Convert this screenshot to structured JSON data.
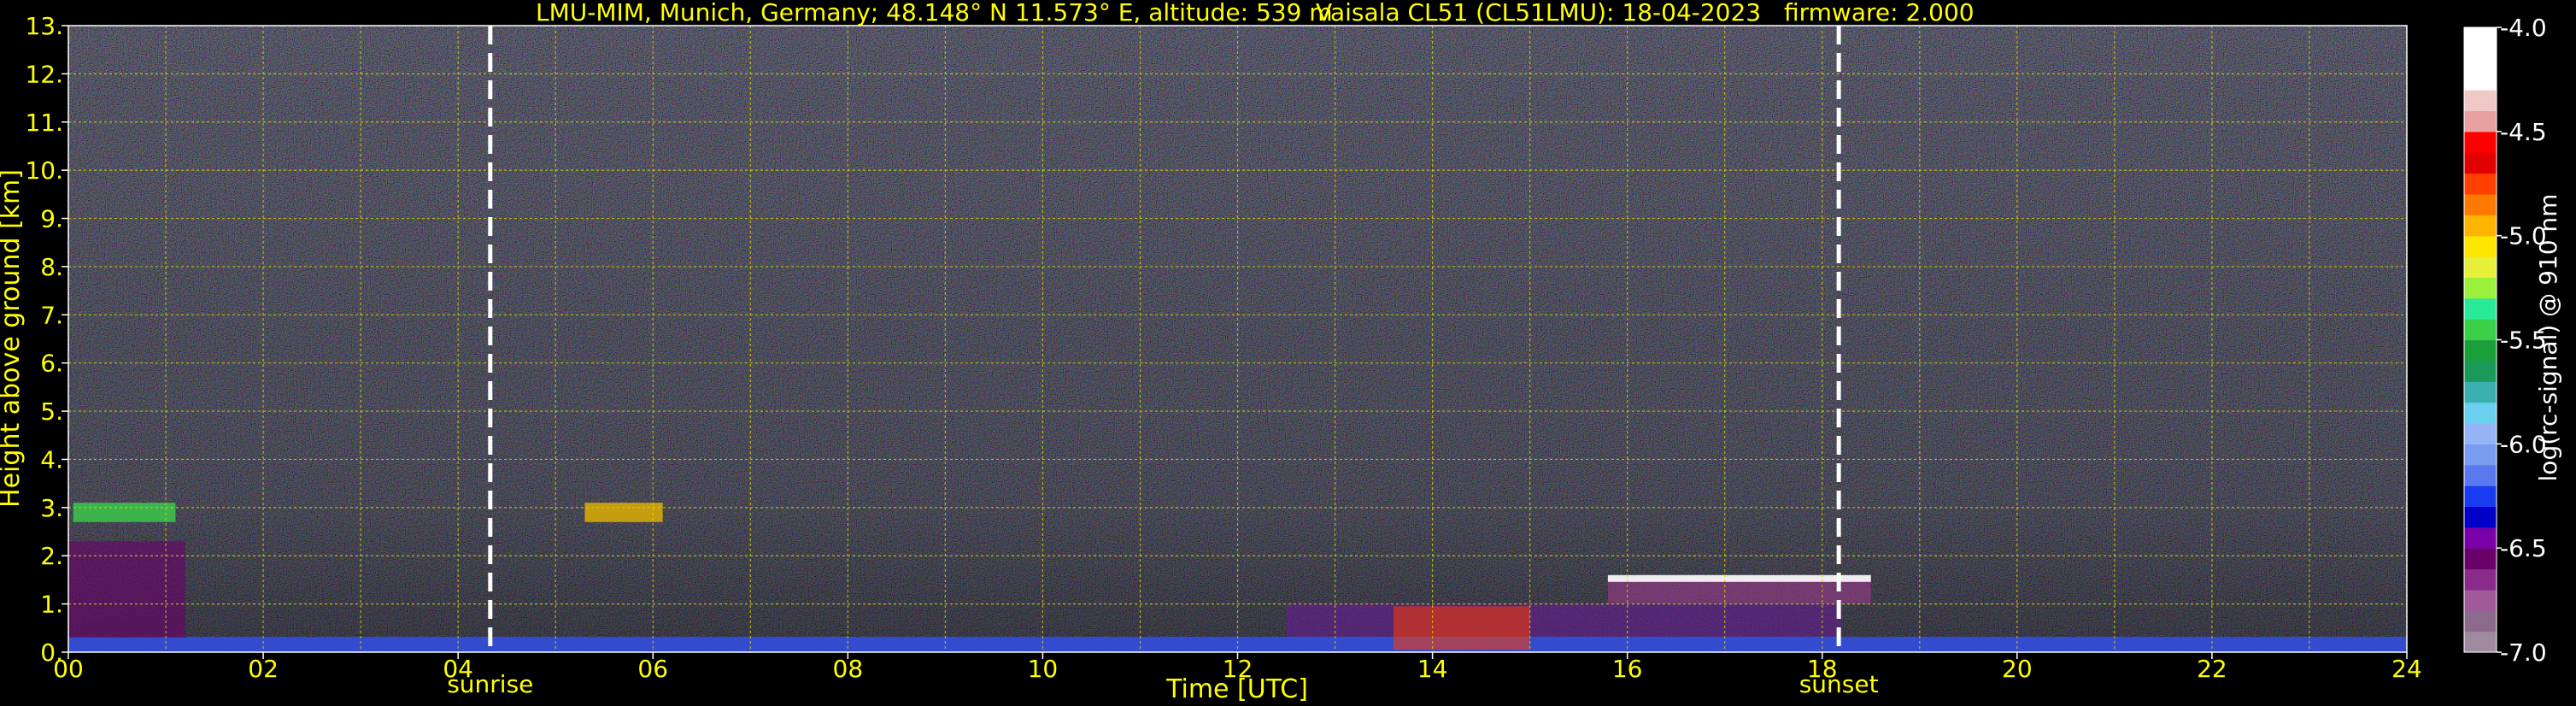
{
  "header": {
    "station": "LMU-MIM, Munich, Germany; 48.148° N 11.573° E, altitude: 539 m",
    "instrument": "Vaisala CL51 (CL51LMU): 18-04-2023",
    "firmware": "firmware: 2.000"
  },
  "chart_data": {
    "type": "heatmap",
    "xlabel": "Time [UTC]",
    "ylabel": "Height above ground [km]",
    "x_ticks": [
      "00",
      "02",
      "04",
      "06",
      "08",
      "10",
      "12",
      "14",
      "16",
      "18",
      "20",
      "22",
      "24"
    ],
    "y_ticks": [
      "0.",
      "1.",
      "2.",
      "3.",
      "4.",
      "5.",
      "6.",
      "7.",
      "8.",
      "9.",
      "10.",
      "11.",
      "12.",
      "13."
    ],
    "xlim": [
      0,
      24
    ],
    "ylim": [
      0,
      13
    ],
    "grid": true,
    "events": [
      {
        "label": "sunrise",
        "time": 4.33
      },
      {
        "label": "sunset",
        "time": 18.17
      }
    ],
    "colorbar": {
      "label": "log(rc-signal) @ 910 nm",
      "range": [
        -7.0,
        -4.0
      ],
      "ticks": [
        "-4.0",
        "-4.5",
        "-5.0",
        "-5.5",
        "-6.0",
        "-6.5",
        "-7.0"
      ],
      "colors": [
        "#a08aa0",
        "#8c6a8c",
        "#a05a9a",
        "#8a2a8a",
        "#6a006a",
        "#7a00a8",
        "#0000c8",
        "#1a3cf0",
        "#5a78f0",
        "#7a9cf0",
        "#96b4f5",
        "#6ad0f0",
        "#3ab0b0",
        "#1a9a5a",
        "#1aa03a",
        "#3ad04a",
        "#2aea9a",
        "#9af03a",
        "#e6f03a",
        "#ffe600",
        "#ffb400",
        "#ff7800",
        "#ff4000",
        "#e00000",
        "#ff0000",
        "#e8a0a0",
        "#f0c8c8",
        "#ffffff",
        "#ffffff",
        "#ffffff"
      ]
    }
  }
}
